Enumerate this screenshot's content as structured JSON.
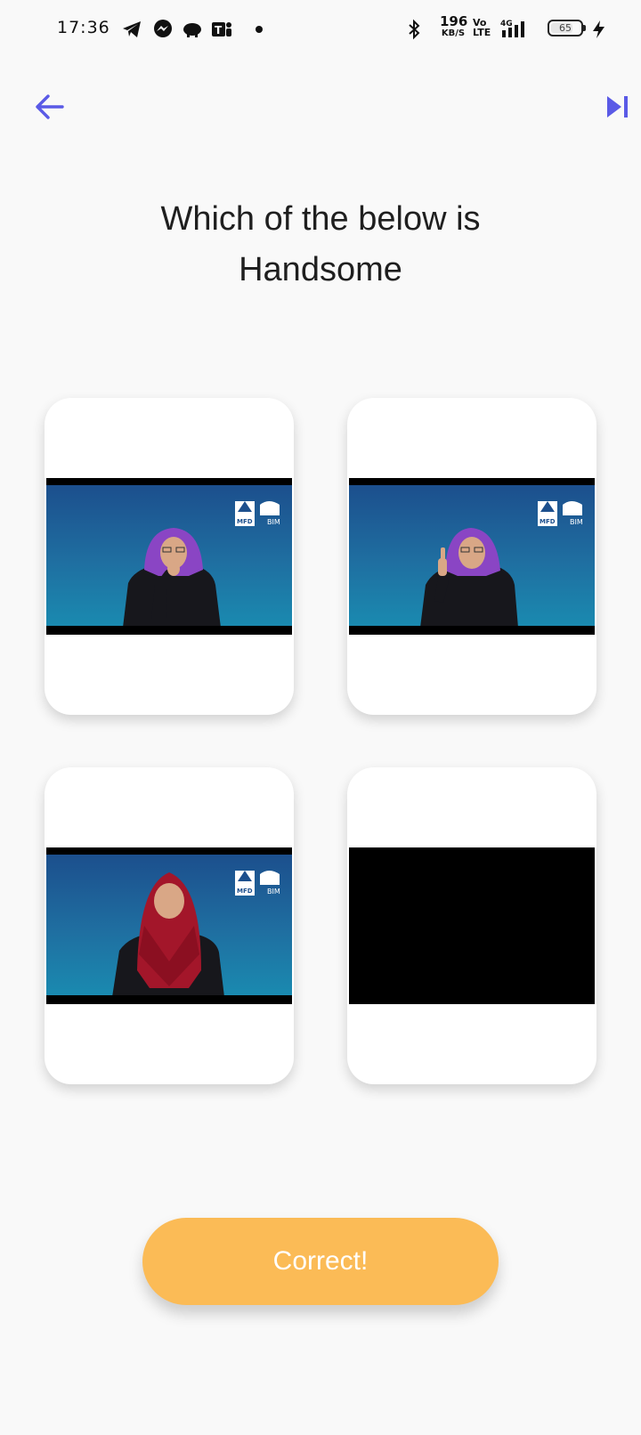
{
  "status_bar": {
    "time": "17:36",
    "network_speed": "196",
    "network_speed_unit": "KB/S",
    "volte_top": "Vo",
    "volte_bottom": "LTE",
    "network_type": "4G",
    "battery_level": "65",
    "notification_icons": [
      "telegram-icon",
      "messenger-icon",
      "piggy-bank-icon",
      "teams-icon"
    ]
  },
  "header": {
    "back_icon": "arrow-left-icon",
    "skip_icon": "skip-next-icon",
    "icon_color": "#5a5ae6"
  },
  "question": {
    "line1": "Which of the below is",
    "line2": "Handsome"
  },
  "options": [
    {
      "type": "video",
      "signer_hijab_color": "#8a45c4",
      "gesture": "hand-at-chin"
    },
    {
      "type": "video",
      "signer_hijab_color": "#8a45c4",
      "gesture": "thumb-up"
    },
    {
      "type": "video",
      "signer_hijab_color": "#a3162a",
      "gesture": "hands-down"
    },
    {
      "type": "video",
      "state": "black-loading"
    }
  ],
  "video_watermark": {
    "logo_left": "MFD",
    "logo_right": "BIM"
  },
  "footer": {
    "button_label": "Correct!",
    "button_color": "#fbbb56"
  }
}
